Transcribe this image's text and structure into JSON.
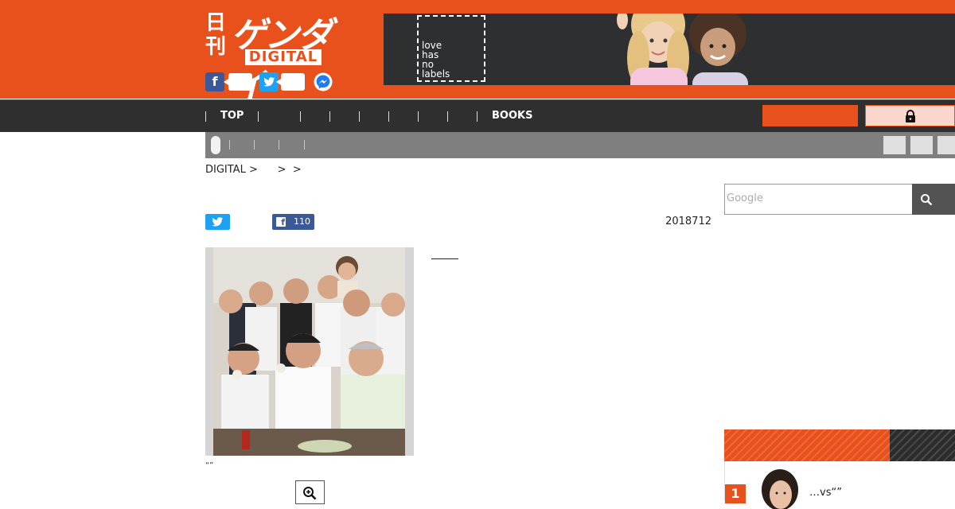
{
  "logo": {
    "kanji_top": "日",
    "kanji_bottom": "刊",
    "kana": "ゲンダイ",
    "digital": "DIGITAL"
  },
  "share": {
    "facebook_glyph": "f",
    "twitter_glyph": "t"
  },
  "ad": {
    "line1": "love",
    "line2": "has",
    "line3": "no",
    "line4": "labels"
  },
  "nav": {
    "items": [
      {
        "label": "TOP"
      },
      {
        "label": ""
      },
      {
        "label": ""
      },
      {
        "label": ""
      },
      {
        "label": ""
      },
      {
        "label": ""
      },
      {
        "label": ""
      },
      {
        "label": "BOOKS"
      }
    ]
  },
  "breadcrumb": {
    "text": "DIGITAL >      >  >"
  },
  "search": {
    "placeholder": "Google"
  },
  "article": {
    "facebook_count": "110",
    "date": "2018712",
    "photo_caption": "“”"
  },
  "ranking": {
    "items": [
      {
        "rank": "1",
        "title": "…vs“”"
      }
    ]
  },
  "colors": {
    "brand_orange": "#e8501c",
    "nav_dark": "#2f2f2f",
    "twitter_blue": "#1da1f2",
    "facebook_blue": "#3b5998"
  }
}
